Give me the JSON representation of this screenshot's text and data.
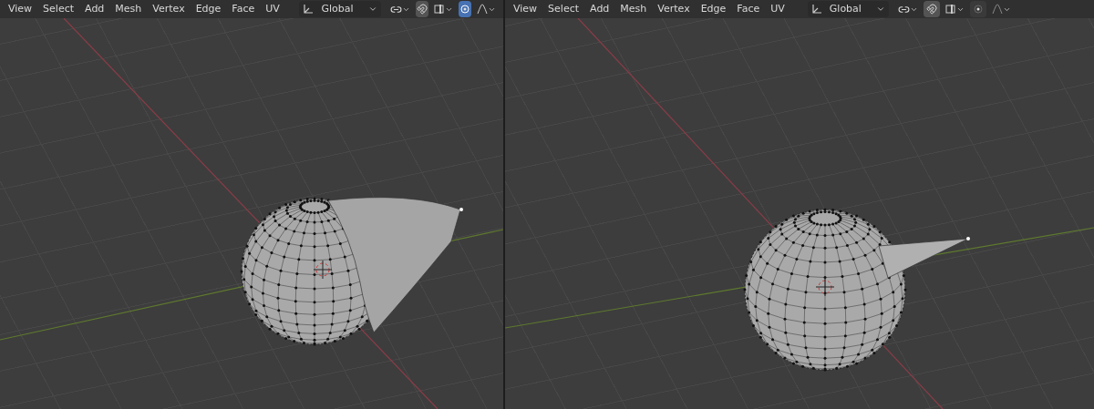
{
  "viewports": [
    {
      "menus": [
        "View",
        "Select",
        "Add",
        "Mesh",
        "Vertex",
        "Edge",
        "Face",
        "UV"
      ],
      "orientation": "Global",
      "snapping": false,
      "proportional_editing": true,
      "kind": "drop"
    },
    {
      "menus": [
        "View",
        "Select",
        "Add",
        "Mesh",
        "Vertex",
        "Edge",
        "Face",
        "UV"
      ],
      "orientation": "Global",
      "snapping": false,
      "proportional_editing": false,
      "kind": "spike"
    }
  ]
}
